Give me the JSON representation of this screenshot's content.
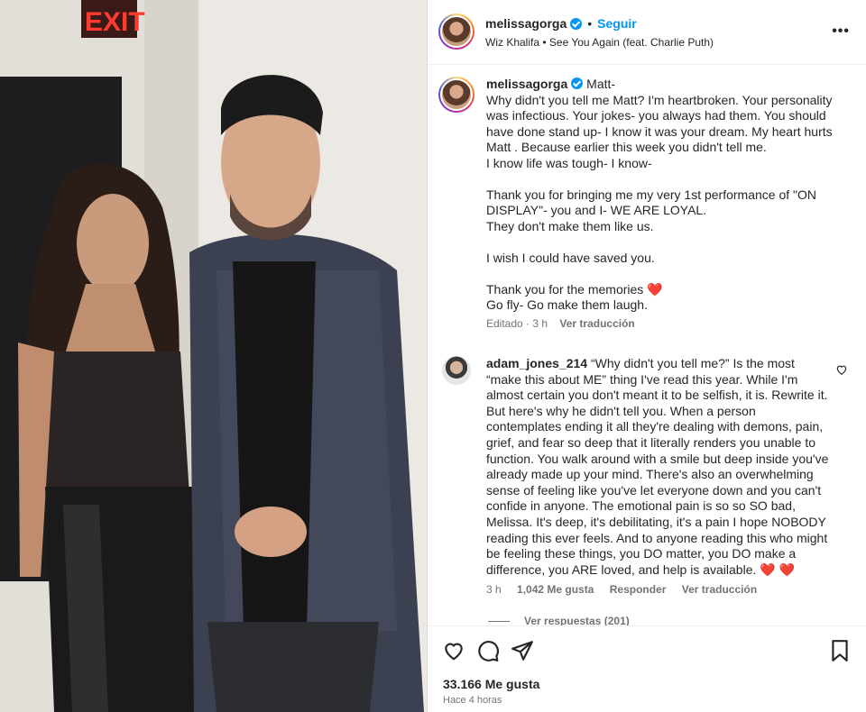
{
  "photo": {
    "sign_text": "EXIT"
  },
  "header": {
    "username": "melissagorga",
    "follow_label": "Seguir",
    "separator": "•",
    "music": "Wiz Khalifa • See You Again (feat. Charlie Puth)",
    "more_icon": "more-horizontal-icon"
  },
  "caption": {
    "username": "melissagorga",
    "text": " Matt-\nWhy didn't you tell me Matt? I'm heartbroken. Your personality was infectious. Your jokes- you always had them. You should have done stand up- I know it was your dream. My heart hurts Matt . Because earlier this week you didn't tell me.\nI know life was tough- I know-\n\nThank you for bringing me my very 1st performance of \"ON DISPLAY\"- you and I- WE ARE LOYAL.\nThey don't make them like us.\n\nI wish I could have saved you.\n\nThank you for the memories ",
    "text_end": "\nGo fly- Go make them laugh.",
    "heart_emoji": "❤️",
    "edited": "Editado · 3 h",
    "translate": "Ver traducción"
  },
  "comment": {
    "username": "adam_jones_214",
    "text": " “Why didn't you tell me?” Is the most “make this about ME” thing I've read this year. While I'm almost certain you don't meant it to be selfish, it is. Rewrite it. But here's why he didn't tell you. When a person contemplates ending it all they're dealing with demons, pain, grief, and fear so deep that it literally renders you unable to function. You walk around with a smile but deep inside you've already made up your mind. There's also an overwhelming sense of feeling like you've let everyone down and you can't confide in anyone. The emotional pain is so so SO bad, Melissa. It's deep, it's debilitating, it's a pain I hope NOBODY reading this ever feels. And to anyone reading this who might be feeling these things, you DO matter, you DO make a difference, you ARE loved, and help is available. ",
    "hearts": "❤️ ❤️",
    "time": "3 h",
    "likes": "1,042 Me gusta",
    "reply": "Responder",
    "translate": "Ver traducción",
    "view_replies": "Ver respuestas (201)"
  },
  "actions": {
    "likes": "33.166 Me gusta",
    "time_ago": "Hace 4 horas"
  },
  "colors": {
    "accent": "#0095f6",
    "heart": "#e0245e",
    "muted": "#737373"
  }
}
